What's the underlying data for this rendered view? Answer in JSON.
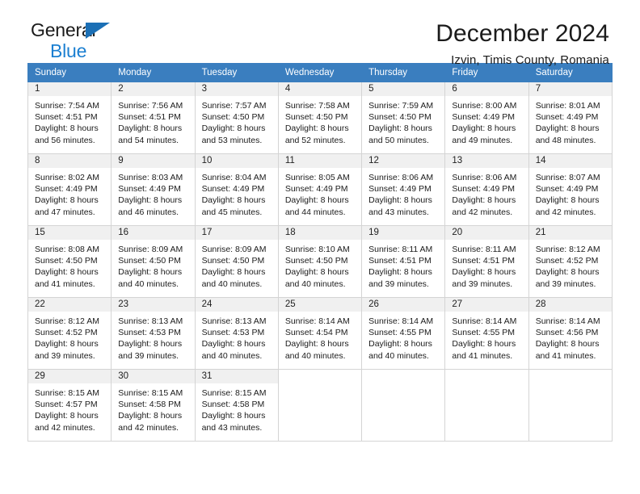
{
  "brand": {
    "name_part1": "General",
    "name_part2": "Blue",
    "mark": "triangle-logo"
  },
  "header": {
    "month_title": "December 2024",
    "location": "Izvin, Timis County, Romania"
  },
  "theme": {
    "header_blue": "#3a7ebf",
    "brand_blue": "#1b7fd1",
    "daynum_bg": "#f0f0f0",
    "grid_border": "#d4d4d4"
  },
  "calendar": {
    "weekday_headers": [
      "Sunday",
      "Monday",
      "Tuesday",
      "Wednesday",
      "Thursday",
      "Friday",
      "Saturday"
    ],
    "weeks": [
      [
        {
          "day": "1",
          "sunrise": "Sunrise: 7:54 AM",
          "sunset": "Sunset: 4:51 PM",
          "daylight1": "Daylight: 8 hours",
          "daylight2": "and 56 minutes."
        },
        {
          "day": "2",
          "sunrise": "Sunrise: 7:56 AM",
          "sunset": "Sunset: 4:51 PM",
          "daylight1": "Daylight: 8 hours",
          "daylight2": "and 54 minutes."
        },
        {
          "day": "3",
          "sunrise": "Sunrise: 7:57 AM",
          "sunset": "Sunset: 4:50 PM",
          "daylight1": "Daylight: 8 hours",
          "daylight2": "and 53 minutes."
        },
        {
          "day": "4",
          "sunrise": "Sunrise: 7:58 AM",
          "sunset": "Sunset: 4:50 PM",
          "daylight1": "Daylight: 8 hours",
          "daylight2": "and 52 minutes."
        },
        {
          "day": "5",
          "sunrise": "Sunrise: 7:59 AM",
          "sunset": "Sunset: 4:50 PM",
          "daylight1": "Daylight: 8 hours",
          "daylight2": "and 50 minutes."
        },
        {
          "day": "6",
          "sunrise": "Sunrise: 8:00 AM",
          "sunset": "Sunset: 4:49 PM",
          "daylight1": "Daylight: 8 hours",
          "daylight2": "and 49 minutes."
        },
        {
          "day": "7",
          "sunrise": "Sunrise: 8:01 AM",
          "sunset": "Sunset: 4:49 PM",
          "daylight1": "Daylight: 8 hours",
          "daylight2": "and 48 minutes."
        }
      ],
      [
        {
          "day": "8",
          "sunrise": "Sunrise: 8:02 AM",
          "sunset": "Sunset: 4:49 PM",
          "daylight1": "Daylight: 8 hours",
          "daylight2": "and 47 minutes."
        },
        {
          "day": "9",
          "sunrise": "Sunrise: 8:03 AM",
          "sunset": "Sunset: 4:49 PM",
          "daylight1": "Daylight: 8 hours",
          "daylight2": "and 46 minutes."
        },
        {
          "day": "10",
          "sunrise": "Sunrise: 8:04 AM",
          "sunset": "Sunset: 4:49 PM",
          "daylight1": "Daylight: 8 hours",
          "daylight2": "and 45 minutes."
        },
        {
          "day": "11",
          "sunrise": "Sunrise: 8:05 AM",
          "sunset": "Sunset: 4:49 PM",
          "daylight1": "Daylight: 8 hours",
          "daylight2": "and 44 minutes."
        },
        {
          "day": "12",
          "sunrise": "Sunrise: 8:06 AM",
          "sunset": "Sunset: 4:49 PM",
          "daylight1": "Daylight: 8 hours",
          "daylight2": "and 43 minutes."
        },
        {
          "day": "13",
          "sunrise": "Sunrise: 8:06 AM",
          "sunset": "Sunset: 4:49 PM",
          "daylight1": "Daylight: 8 hours",
          "daylight2": "and 42 minutes."
        },
        {
          "day": "14",
          "sunrise": "Sunrise: 8:07 AM",
          "sunset": "Sunset: 4:49 PM",
          "daylight1": "Daylight: 8 hours",
          "daylight2": "and 42 minutes."
        }
      ],
      [
        {
          "day": "15",
          "sunrise": "Sunrise: 8:08 AM",
          "sunset": "Sunset: 4:50 PM",
          "daylight1": "Daylight: 8 hours",
          "daylight2": "and 41 minutes."
        },
        {
          "day": "16",
          "sunrise": "Sunrise: 8:09 AM",
          "sunset": "Sunset: 4:50 PM",
          "daylight1": "Daylight: 8 hours",
          "daylight2": "and 40 minutes."
        },
        {
          "day": "17",
          "sunrise": "Sunrise: 8:09 AM",
          "sunset": "Sunset: 4:50 PM",
          "daylight1": "Daylight: 8 hours",
          "daylight2": "and 40 minutes."
        },
        {
          "day": "18",
          "sunrise": "Sunrise: 8:10 AM",
          "sunset": "Sunset: 4:50 PM",
          "daylight1": "Daylight: 8 hours",
          "daylight2": "and 40 minutes."
        },
        {
          "day": "19",
          "sunrise": "Sunrise: 8:11 AM",
          "sunset": "Sunset: 4:51 PM",
          "daylight1": "Daylight: 8 hours",
          "daylight2": "and 39 minutes."
        },
        {
          "day": "20",
          "sunrise": "Sunrise: 8:11 AM",
          "sunset": "Sunset: 4:51 PM",
          "daylight1": "Daylight: 8 hours",
          "daylight2": "and 39 minutes."
        },
        {
          "day": "21",
          "sunrise": "Sunrise: 8:12 AM",
          "sunset": "Sunset: 4:52 PM",
          "daylight1": "Daylight: 8 hours",
          "daylight2": "and 39 minutes."
        }
      ],
      [
        {
          "day": "22",
          "sunrise": "Sunrise: 8:12 AM",
          "sunset": "Sunset: 4:52 PM",
          "daylight1": "Daylight: 8 hours",
          "daylight2": "and 39 minutes."
        },
        {
          "day": "23",
          "sunrise": "Sunrise: 8:13 AM",
          "sunset": "Sunset: 4:53 PM",
          "daylight1": "Daylight: 8 hours",
          "daylight2": "and 39 minutes."
        },
        {
          "day": "24",
          "sunrise": "Sunrise: 8:13 AM",
          "sunset": "Sunset: 4:53 PM",
          "daylight1": "Daylight: 8 hours",
          "daylight2": "and 40 minutes."
        },
        {
          "day": "25",
          "sunrise": "Sunrise: 8:14 AM",
          "sunset": "Sunset: 4:54 PM",
          "daylight1": "Daylight: 8 hours",
          "daylight2": "and 40 minutes."
        },
        {
          "day": "26",
          "sunrise": "Sunrise: 8:14 AM",
          "sunset": "Sunset: 4:55 PM",
          "daylight1": "Daylight: 8 hours",
          "daylight2": "and 40 minutes."
        },
        {
          "day": "27",
          "sunrise": "Sunrise: 8:14 AM",
          "sunset": "Sunset: 4:55 PM",
          "daylight1": "Daylight: 8 hours",
          "daylight2": "and 41 minutes."
        },
        {
          "day": "28",
          "sunrise": "Sunrise: 8:14 AM",
          "sunset": "Sunset: 4:56 PM",
          "daylight1": "Daylight: 8 hours",
          "daylight2": "and 41 minutes."
        }
      ],
      [
        {
          "day": "29",
          "sunrise": "Sunrise: 8:15 AM",
          "sunset": "Sunset: 4:57 PM",
          "daylight1": "Daylight: 8 hours",
          "daylight2": "and 42 minutes."
        },
        {
          "day": "30",
          "sunrise": "Sunrise: 8:15 AM",
          "sunset": "Sunset: 4:58 PM",
          "daylight1": "Daylight: 8 hours",
          "daylight2": "and 42 minutes."
        },
        {
          "day": "31",
          "sunrise": "Sunrise: 8:15 AM",
          "sunset": "Sunset: 4:58 PM",
          "daylight1": "Daylight: 8 hours",
          "daylight2": "and 43 minutes."
        },
        {
          "day": "",
          "sunrise": "",
          "sunset": "",
          "daylight1": "",
          "daylight2": ""
        },
        {
          "day": "",
          "sunrise": "",
          "sunset": "",
          "daylight1": "",
          "daylight2": ""
        },
        {
          "day": "",
          "sunrise": "",
          "sunset": "",
          "daylight1": "",
          "daylight2": ""
        },
        {
          "day": "",
          "sunrise": "",
          "sunset": "",
          "daylight1": "",
          "daylight2": ""
        }
      ]
    ]
  }
}
